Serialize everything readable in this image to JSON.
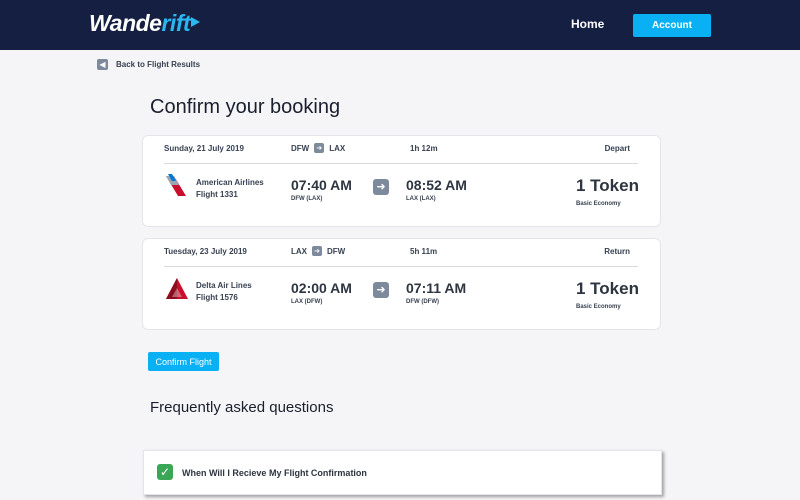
{
  "header": {
    "logo_part1": "Wande",
    "logo_part2": "rift",
    "nav_home": "Home",
    "account_button": "Account"
  },
  "back_link": "Back to Flight Results",
  "page_title": "Confirm your booking",
  "flights": [
    {
      "date": "Sunday, 21 July 2019",
      "from": "DFW",
      "to": "LAX",
      "duration": "1h 12m",
      "direction": "Depart",
      "airline": "American Airlines",
      "flight_number": "Flight 1331",
      "logo_icon": "american-airlines-logo-icon",
      "depart_time": "07:40 AM",
      "depart_code": "DFW (LAX)",
      "arrive_time": "08:52 AM",
      "arrive_code": "LAX (LAX)",
      "price": "1 Token",
      "cabin": "Basic Economy"
    },
    {
      "date": "Tuesday, 23 July 2019",
      "from": "LAX",
      "to": "DFW",
      "duration": "5h 11m",
      "direction": "Return",
      "airline": "Delta Air Lines",
      "flight_number": "Flight 1576",
      "logo_icon": "delta-logo-icon",
      "depart_time": "02:00 AM",
      "depart_code": "LAX (DFW)",
      "arrive_time": "07:11 AM",
      "arrive_code": "DFW (DFW)",
      "price": "1 Token",
      "cabin": "Basic Economy"
    }
  ],
  "confirm_button": "Confirm Flight",
  "faq": {
    "title": "Frequently asked questions",
    "items": [
      {
        "question": "When Will I Recieve My Flight Confirmation",
        "icon": "check-mark-icon"
      }
    ]
  },
  "colors": {
    "header_bg": "#151f42",
    "accent": "#0ab0f4",
    "page_bg": "#f5f5f7"
  }
}
